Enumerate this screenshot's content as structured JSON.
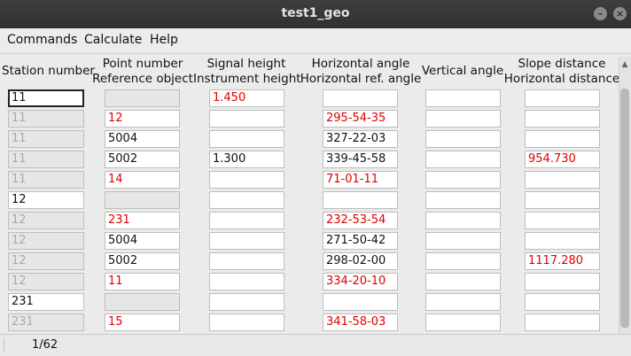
{
  "window": {
    "title": "test1_geo"
  },
  "menu": {
    "commands": "Commands",
    "calculate": "Calculate",
    "help": "Help"
  },
  "headers": {
    "station": [
      "Station number"
    ],
    "point": [
      "Point number",
      "Reference object"
    ],
    "signal": [
      "Signal height",
      "Instrument height"
    ],
    "hangle": [
      "Horizontal angle",
      "Horizontal ref. angle"
    ],
    "vangle": [
      "Vertical angle"
    ],
    "dist": [
      "Slope distance",
      "Horizontal distance"
    ]
  },
  "rows": [
    {
      "type": "station",
      "station": "11",
      "point": "",
      "signal": "1.450",
      "signal_color": "red",
      "hangle": "",
      "hangle_color": "black",
      "vangle": "",
      "dist": "",
      "dist_color": "black"
    },
    {
      "type": "obs",
      "station": "11",
      "point": "12",
      "point_color": "red",
      "signal": "",
      "hangle": "295-54-35",
      "hangle_color": "red",
      "vangle": "",
      "dist": "",
      "dist_color": "black"
    },
    {
      "type": "obs",
      "station": "11",
      "point": "5004",
      "point_color": "black",
      "signal": "",
      "hangle": "327-22-03",
      "hangle_color": "black",
      "vangle": "",
      "dist": "",
      "dist_color": "black"
    },
    {
      "type": "obs",
      "station": "11",
      "point": "5002",
      "point_color": "black",
      "signal": "1.300",
      "signal_color": "black",
      "hangle": "339-45-58",
      "hangle_color": "black",
      "vangle": "",
      "dist": "954.730",
      "dist_color": "red"
    },
    {
      "type": "obs",
      "station": "11",
      "point": "14",
      "point_color": "red",
      "signal": "",
      "hangle": " 71-01-11",
      "hangle_color": "red",
      "vangle": "",
      "dist": "",
      "dist_color": "black"
    },
    {
      "type": "station",
      "station": "12",
      "point": "",
      "signal": "",
      "hangle": "",
      "hangle_color": "black",
      "vangle": "",
      "dist": "",
      "dist_color": "black"
    },
    {
      "type": "obs",
      "station": "12",
      "point": "231",
      "point_color": "red",
      "signal": "",
      "hangle": "232-53-54",
      "hangle_color": "red",
      "vangle": "",
      "dist": "",
      "dist_color": "black"
    },
    {
      "type": "obs",
      "station": "12",
      "point": "5004",
      "point_color": "black",
      "signal": "",
      "hangle": "271-50-42",
      "hangle_color": "black",
      "vangle": "",
      "dist": "",
      "dist_color": "black"
    },
    {
      "type": "obs",
      "station": "12",
      "point": "5002",
      "point_color": "black",
      "signal": "",
      "hangle": "298-02-00",
      "hangle_color": "black",
      "vangle": "",
      "dist": "1117.280",
      "dist_color": "red"
    },
    {
      "type": "obs",
      "station": "12",
      "point": "11",
      "point_color": "red",
      "signal": "",
      "hangle": "334-20-10",
      "hangle_color": "red",
      "vangle": "",
      "dist": "",
      "dist_color": "black"
    },
    {
      "type": "station",
      "station": "231",
      "point": "",
      "signal": "",
      "hangle": "",
      "hangle_color": "black",
      "vangle": "",
      "dist": "",
      "dist_color": "black"
    },
    {
      "type": "obs",
      "station": "231",
      "point": "15",
      "point_color": "red",
      "signal": "",
      "hangle": "341-58-03",
      "hangle_color": "red",
      "vangle": "",
      "dist": "",
      "dist_color": "black"
    }
  ],
  "status": {
    "text": "1/62"
  },
  "colors": {
    "red": "#e00000",
    "black": "#111111",
    "disabled": "#aaaaaa"
  }
}
